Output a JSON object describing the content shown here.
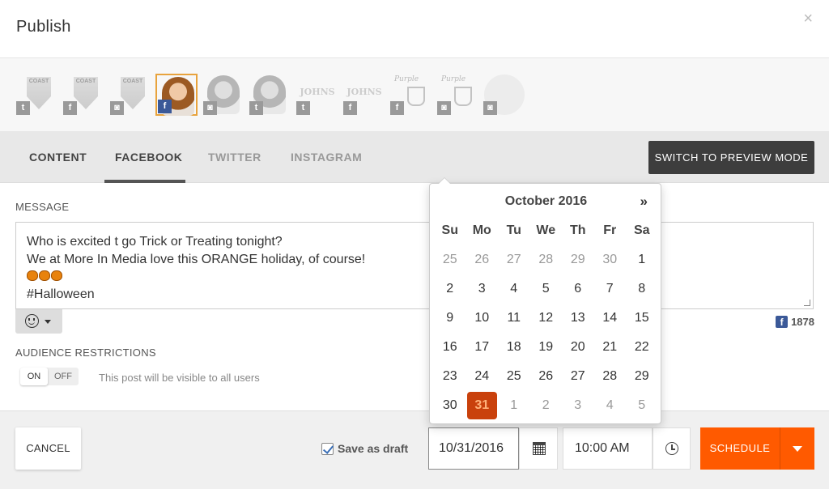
{
  "modal": {
    "title": "Publish",
    "close_glyph": "×"
  },
  "profiles": [
    {
      "brand": "COAST",
      "network": "twitter",
      "net_glyph": "t",
      "selected": false
    },
    {
      "brand": "COAST",
      "network": "facebook",
      "net_glyph": "f",
      "selected": false
    },
    {
      "brand": "COAST",
      "network": "instagram",
      "net_glyph": "◙",
      "selected": false
    },
    {
      "brand": "person-photo",
      "network": "facebook",
      "net_glyph": "f",
      "selected": true
    },
    {
      "brand": "person-photo",
      "network": "instagram",
      "net_glyph": "◙",
      "selected": false
    },
    {
      "brand": "person-photo",
      "network": "twitter",
      "net_glyph": "t",
      "selected": false
    },
    {
      "brand": "JOHNS",
      "network": "twitter",
      "net_glyph": "t",
      "selected": false
    },
    {
      "brand": "JOHNS",
      "network": "facebook",
      "net_glyph": "f",
      "selected": false
    },
    {
      "brand": "Purple",
      "network": "facebook",
      "net_glyph": "f",
      "selected": false
    },
    {
      "brand": "Purple",
      "network": "instagram",
      "net_glyph": "◙",
      "selected": false
    },
    {
      "brand": "circle-logo",
      "network": "instagram",
      "net_glyph": "◙",
      "selected": false
    }
  ],
  "tabs": {
    "content": "CONTENT",
    "facebook": "FACEBOOK",
    "twitter": "TWITTER",
    "instagram": "INSTAGRAM",
    "active": "FACEBOOK"
  },
  "preview_button": "SWITCH TO PREVIEW MODE",
  "message": {
    "label": "MESSAGE",
    "lines": [
      "Who is excited t go Trick or Treating tonight?",
      "We at More In Media love this ORANGE holiday, of course!",
      "",
      "#Halloween"
    ],
    "pumpkin_count": 3,
    "emoji_icon": "smiley-icon",
    "facebook_followers": "1878"
  },
  "audience": {
    "label": "AUDIENCE RESTRICTIONS",
    "on": "ON",
    "off": "OFF",
    "state": "ON",
    "note": "This post will be visible to all users"
  },
  "datepicker": {
    "month_label": "October 2016",
    "next": "»",
    "weekdays": [
      "Su",
      "Mo",
      "Tu",
      "We",
      "Th",
      "Fr",
      "Sa"
    ],
    "weeks": [
      [
        "25",
        "26",
        "27",
        "28",
        "29",
        "30",
        "1"
      ],
      [
        "2",
        "3",
        "4",
        "5",
        "6",
        "7",
        "8"
      ],
      [
        "9",
        "10",
        "11",
        "12",
        "13",
        "14",
        "15"
      ],
      [
        "16",
        "17",
        "18",
        "19",
        "20",
        "21",
        "22"
      ],
      [
        "23",
        "24",
        "25",
        "26",
        "27",
        "28",
        "29"
      ],
      [
        "30",
        "31",
        "1",
        "2",
        "3",
        "4",
        "5"
      ]
    ],
    "selected_day": "31",
    "selected_color": "#c9410c"
  },
  "footer": {
    "cancel": "CANCEL",
    "save_draft": "Save as draft",
    "save_draft_checked": true,
    "date_value": "10/31/2016",
    "time_value": "10:00 AM",
    "schedule": "SCHEDULE",
    "accent": "#ff5a00"
  }
}
